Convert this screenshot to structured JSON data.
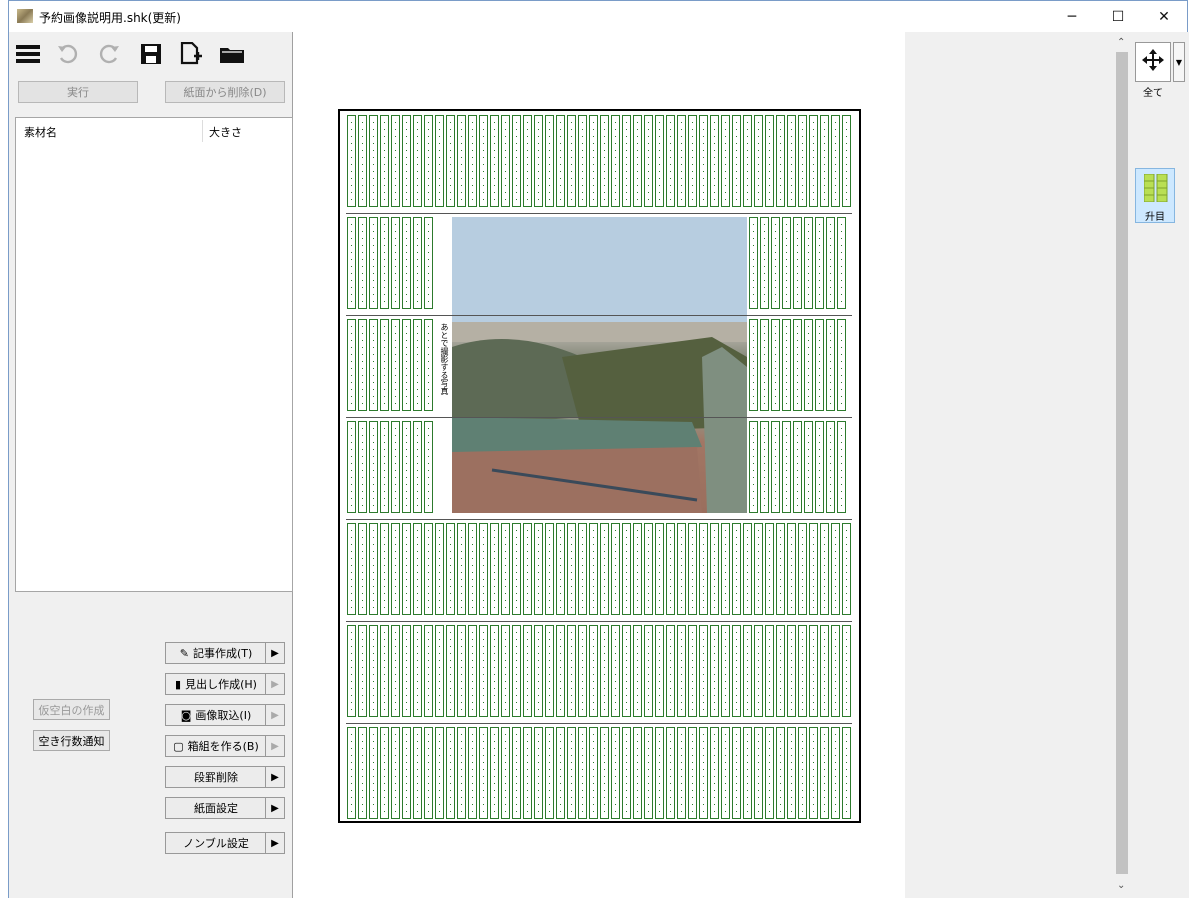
{
  "window": {
    "title": "予約画像説明用.shk(更新)",
    "minimize": "─",
    "maximize": "☐",
    "close": "✕"
  },
  "toolbar": {
    "icons": [
      "menu-icon",
      "undo-icon",
      "redo-icon",
      "save-icon",
      "new-file-icon",
      "open-folder-icon"
    ]
  },
  "actions": {
    "execute": "実行",
    "remove_from_paper": "紙面から削除(D)"
  },
  "material_list": {
    "columns": [
      "素材名",
      "大きさ"
    ],
    "rows": []
  },
  "commands": [
    {
      "icon": "✎",
      "label": "記事作成(T)",
      "arrow_enabled": true
    },
    {
      "icon": "▮",
      "label": "見出し作成(H)",
      "arrow_enabled": false
    },
    {
      "icon": "◙",
      "label": "画像取込(I)",
      "arrow_enabled": false
    },
    {
      "icon": "▢",
      "label": "箱組を作る(B)",
      "arrow_enabled": false
    },
    {
      "icon": "",
      "label": "段罫削除",
      "arrow_enabled": true
    },
    {
      "icon": "",
      "label": "紙面設定",
      "arrow_enabled": true
    },
    {
      "icon": "",
      "label": "ノンブル設定",
      "arrow_enabled": true
    }
  ],
  "side_buttons": {
    "provisional_blank": "仮空白の作成",
    "empty_lines_notice": "空き行数通知"
  },
  "canvas": {
    "photo_caption": "あとで撮影する写真"
  },
  "right_panel": {
    "move_label": "全て",
    "grid_label": "升目"
  },
  "colors": {
    "grid": "#2d7a2d",
    "highlight": "#cde8ff"
  }
}
